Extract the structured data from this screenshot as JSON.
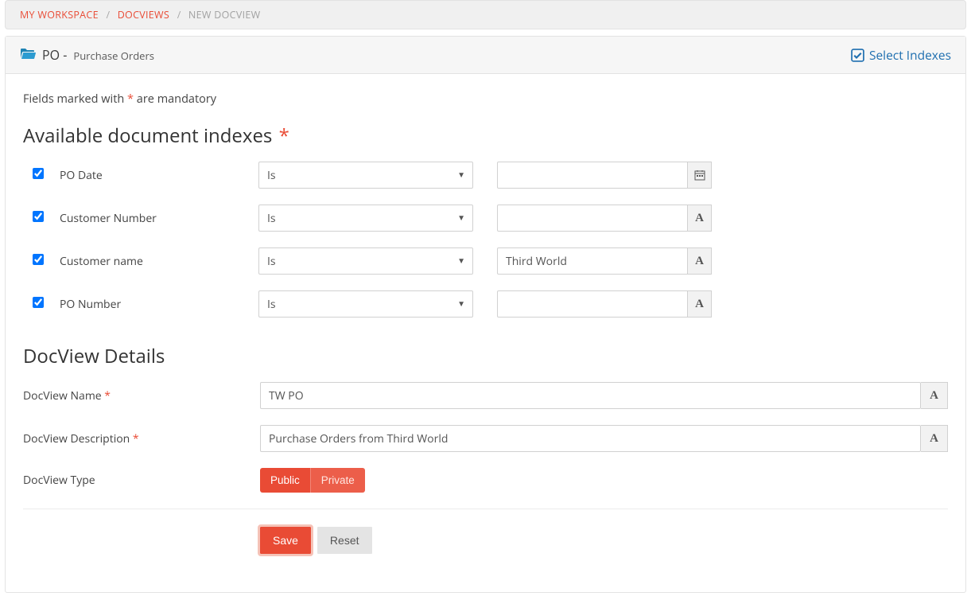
{
  "breadcrumb": {
    "items": [
      "MY WORKSPACE",
      "DOCVIEWS",
      "NEW DOCVIEW"
    ]
  },
  "header": {
    "code": "PO",
    "subtitle": "Purchase Orders",
    "select_indexes_label": "Select Indexes"
  },
  "notes": {
    "mandatory_pre": "Fields marked with ",
    "mandatory_star": "*",
    "mandatory_post": " are mandatory"
  },
  "sections": {
    "indexes_title": "Available document indexes",
    "details_title": "DocView Details"
  },
  "indexes": [
    {
      "label": "PO Date",
      "operator": "Is",
      "value": "",
      "addon": "calendar"
    },
    {
      "label": "Customer Number",
      "operator": "Is",
      "value": "",
      "addon": "A"
    },
    {
      "label": "Customer name",
      "operator": "Is",
      "value": "Third World",
      "addon": "A"
    },
    {
      "label": "PO Number",
      "operator": "Is",
      "value": "",
      "addon": "A"
    }
  ],
  "details": {
    "name_label": "DocView Name",
    "name_value": "TW PO",
    "desc_label": "DocView Description",
    "desc_value": "Purchase Orders from Third World",
    "type_label": "DocView Type",
    "type_public": "Public",
    "type_private": "Private"
  },
  "actions": {
    "save": "Save",
    "reset": "Reset"
  }
}
